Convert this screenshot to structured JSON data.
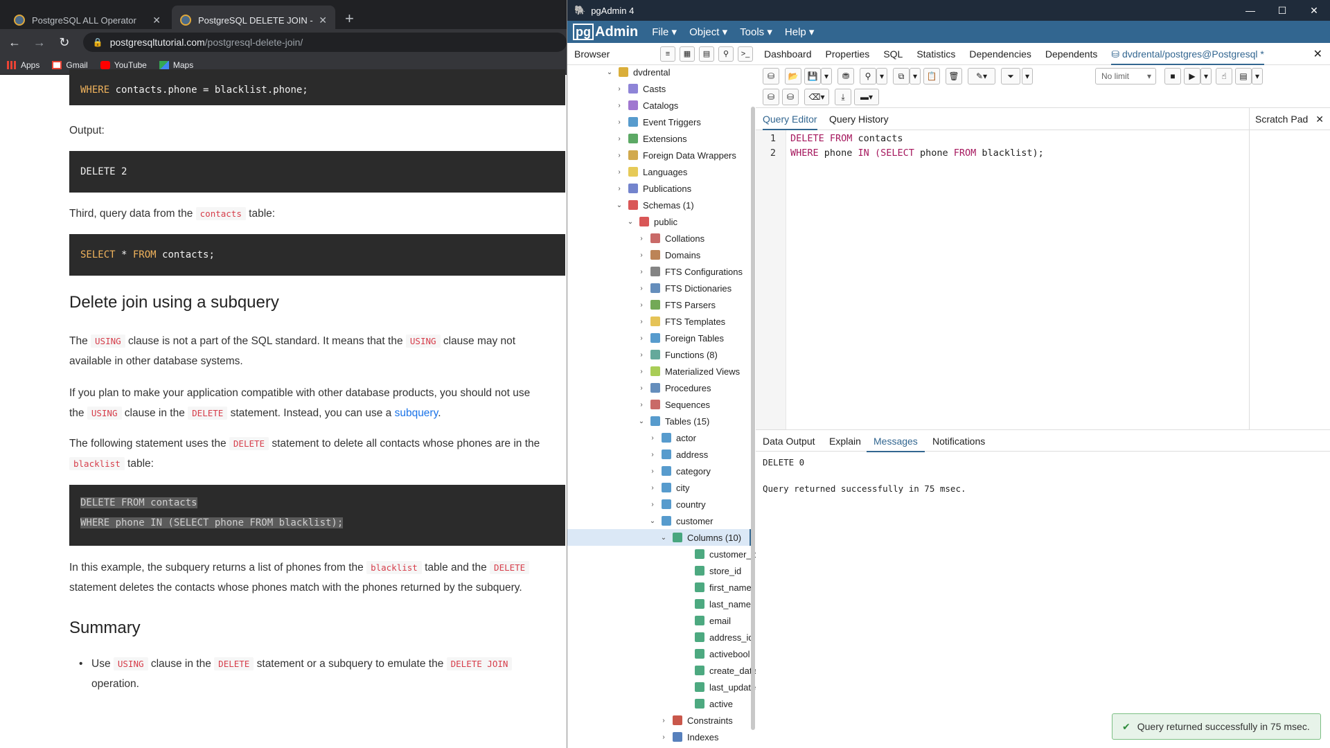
{
  "browser": {
    "tabs": [
      {
        "title": "PostgreSQL ALL Operator"
      },
      {
        "title": "PostgreSQL DELETE JOIN - How t"
      }
    ],
    "url_host": "postgresqltutorial.com",
    "url_path": "/postgresql-delete-join/",
    "bookmarks": [
      "Apps",
      "Gmail",
      "YouTube",
      "Maps"
    ]
  },
  "article": {
    "code1_kw": "WHERE",
    "code1_rest": " contacts.phone = blacklist.phone;",
    "output_label": "Output:",
    "code2": "DELETE 2",
    "p_third_a": "Third, query data from the ",
    "p_third_code": "contacts",
    "p_third_b": " table:",
    "code3_kw1": "SELECT",
    "code3_mid": " * ",
    "code3_kw2": "FROM",
    "code3_rest": " contacts;",
    "h_subquery": "Delete join using a subquery",
    "p1_a": "The ",
    "p1_code1": "USING",
    "p1_b": " clause is not a part of the SQL standard. It means that the ",
    "p1_code2": "USING",
    "p1_c": " clause may not",
    "p1_d": "available in other database systems.",
    "p2_a": "If you plan to make your application compatible with other database products, you should not use",
    "p2_b": "the ",
    "p2_code1": "USING",
    "p2_c": " clause in the ",
    "p2_code2": "DELETE",
    "p2_d": " statement. Instead, you can use a ",
    "p2_link": "subquery",
    "p2_e": ".",
    "p3_a": "The following statement uses the ",
    "p3_code1": "DELETE",
    "p3_b": " statement to delete all contacts whose phones are in the",
    "p3_code2": "blacklist",
    "p3_c": " table:",
    "code4_l1": "DELETE FROM contacts",
    "code4_l2": "WHERE phone IN (SELECT phone FROM blacklist);",
    "p4_a": "In this example, the subquery returns a list of phones from the ",
    "p4_code1": "blacklist",
    "p4_b": " table and the ",
    "p4_code2": "DELETE",
    "p4_c": "statement deletes the contacts whose phones match with the phones returned by the subquery.",
    "h_summary": "Summary",
    "li_a": "Use ",
    "li_code1": "USING",
    "li_b": " clause in the ",
    "li_code2": "DELETE",
    "li_c": " statement or a subquery to emulate the ",
    "li_code3": "DELETE JOIN",
    "li_d": "operation."
  },
  "pgadmin": {
    "window_title": "pgAdmin 4",
    "logo_pg": "pg",
    "logo_admin": "Admin",
    "menus": [
      "File",
      "Object",
      "Tools",
      "Help"
    ],
    "browser_label": "Browser",
    "main_tabs": [
      "Dashboard",
      "Properties",
      "SQL",
      "Statistics",
      "Dependencies",
      "Dependents",
      "dvdrental/postgres@Postgresql *"
    ],
    "limit": "No limit",
    "editor_tabs": [
      "Query Editor",
      "Query History"
    ],
    "scratch_pad": "Scratch Pad",
    "query_lines": [
      {
        "n": "1",
        "k1": "DELETE FROM",
        "r1": " contacts",
        "p": "",
        "k2": "",
        "r2": "",
        "k3": "",
        "r3": ""
      },
      {
        "n": "2",
        "k1": "WHERE",
        "r1": " phone ",
        "p": "IN",
        "k2": " (SELECT",
        "r2": " phone ",
        "k3": "FROM",
        "r3": " blacklist);"
      }
    ],
    "output_tabs": [
      "Data Output",
      "Explain",
      "Messages",
      "Notifications"
    ],
    "message_1": "DELETE 0",
    "message_2": "Query returned successfully in 75 msec.",
    "toast": "Query returned successfully in 75 msec.",
    "tree": [
      {
        "label": "dvdrental",
        "icon_color": "#d4a017"
      },
      {
        "label": "Casts",
        "icon_color": "#7a6fd0"
      },
      {
        "label": "Catalogs",
        "icon_color": "#8f5fc8"
      },
      {
        "label": "Event Triggers",
        "icon_color": "#3a8ac4"
      },
      {
        "label": "Extensions",
        "icon_color": "#3f9a4a"
      },
      {
        "label": "Foreign Data Wrappers",
        "icon_color": "#c99a2e"
      },
      {
        "label": "Languages",
        "icon_color": "#e2c13b"
      },
      {
        "label": "Publications",
        "icon_color": "#5a6fc4"
      },
      {
        "label": "Schemas (1)",
        "icon_color": "#d23a3a"
      },
      {
        "label": "public",
        "icon_color": "#d23a3a"
      },
      {
        "label": "Collations",
        "icon_color": "#c0504d"
      },
      {
        "label": "Domains",
        "icon_color": "#b06f3a"
      },
      {
        "label": "FTS Configurations",
        "icon_color": "#6f6f6f"
      },
      {
        "label": "FTS Dictionaries",
        "icon_color": "#4a7ab0"
      },
      {
        "label": "FTS Parsers",
        "icon_color": "#5a9a3a"
      },
      {
        "label": "FTS Templates",
        "icon_color": "#e0b83a"
      },
      {
        "label": "Foreign Tables",
        "icon_color": "#3a8ac4"
      },
      {
        "label": "Functions (8)",
        "icon_color": "#4a9a8a"
      },
      {
        "label": "Materialized Views",
        "icon_color": "#9ac43a"
      },
      {
        "label": "Procedures",
        "icon_color": "#4a7ab0"
      },
      {
        "label": "Sequences",
        "icon_color": "#c0504d"
      },
      {
        "label": "Tables (15)",
        "icon_color": "#3a8ac4"
      },
      {
        "label": "actor",
        "icon_color": "#3a8ac4"
      },
      {
        "label": "address",
        "icon_color": "#3a8ac4"
      },
      {
        "label": "category",
        "icon_color": "#3a8ac4"
      },
      {
        "label": "city",
        "icon_color": "#3a8ac4"
      },
      {
        "label": "country",
        "icon_color": "#3a8ac4"
      },
      {
        "label": "customer",
        "icon_color": "#3a8ac4"
      },
      {
        "label": "Columns (10)",
        "icon_color": "#2e9a6a"
      },
      {
        "label": "customer_id",
        "icon_color": "#2e9a6a"
      },
      {
        "label": "store_id",
        "icon_color": "#2e9a6a"
      },
      {
        "label": "first_name",
        "icon_color": "#2e9a6a"
      },
      {
        "label": "last_name",
        "icon_color": "#2e9a6a"
      },
      {
        "label": "email",
        "icon_color": "#2e9a6a"
      },
      {
        "label": "address_id",
        "icon_color": "#2e9a6a"
      },
      {
        "label": "activebool",
        "icon_color": "#2e9a6a"
      },
      {
        "label": "create_date",
        "icon_color": "#2e9a6a"
      },
      {
        "label": "last_update",
        "icon_color": "#2e9a6a"
      },
      {
        "label": "active",
        "icon_color": "#2e9a6a"
      },
      {
        "label": "Constraints",
        "icon_color": "#c0392b"
      },
      {
        "label": "Indexes",
        "icon_color": "#3a6ab0"
      }
    ]
  }
}
